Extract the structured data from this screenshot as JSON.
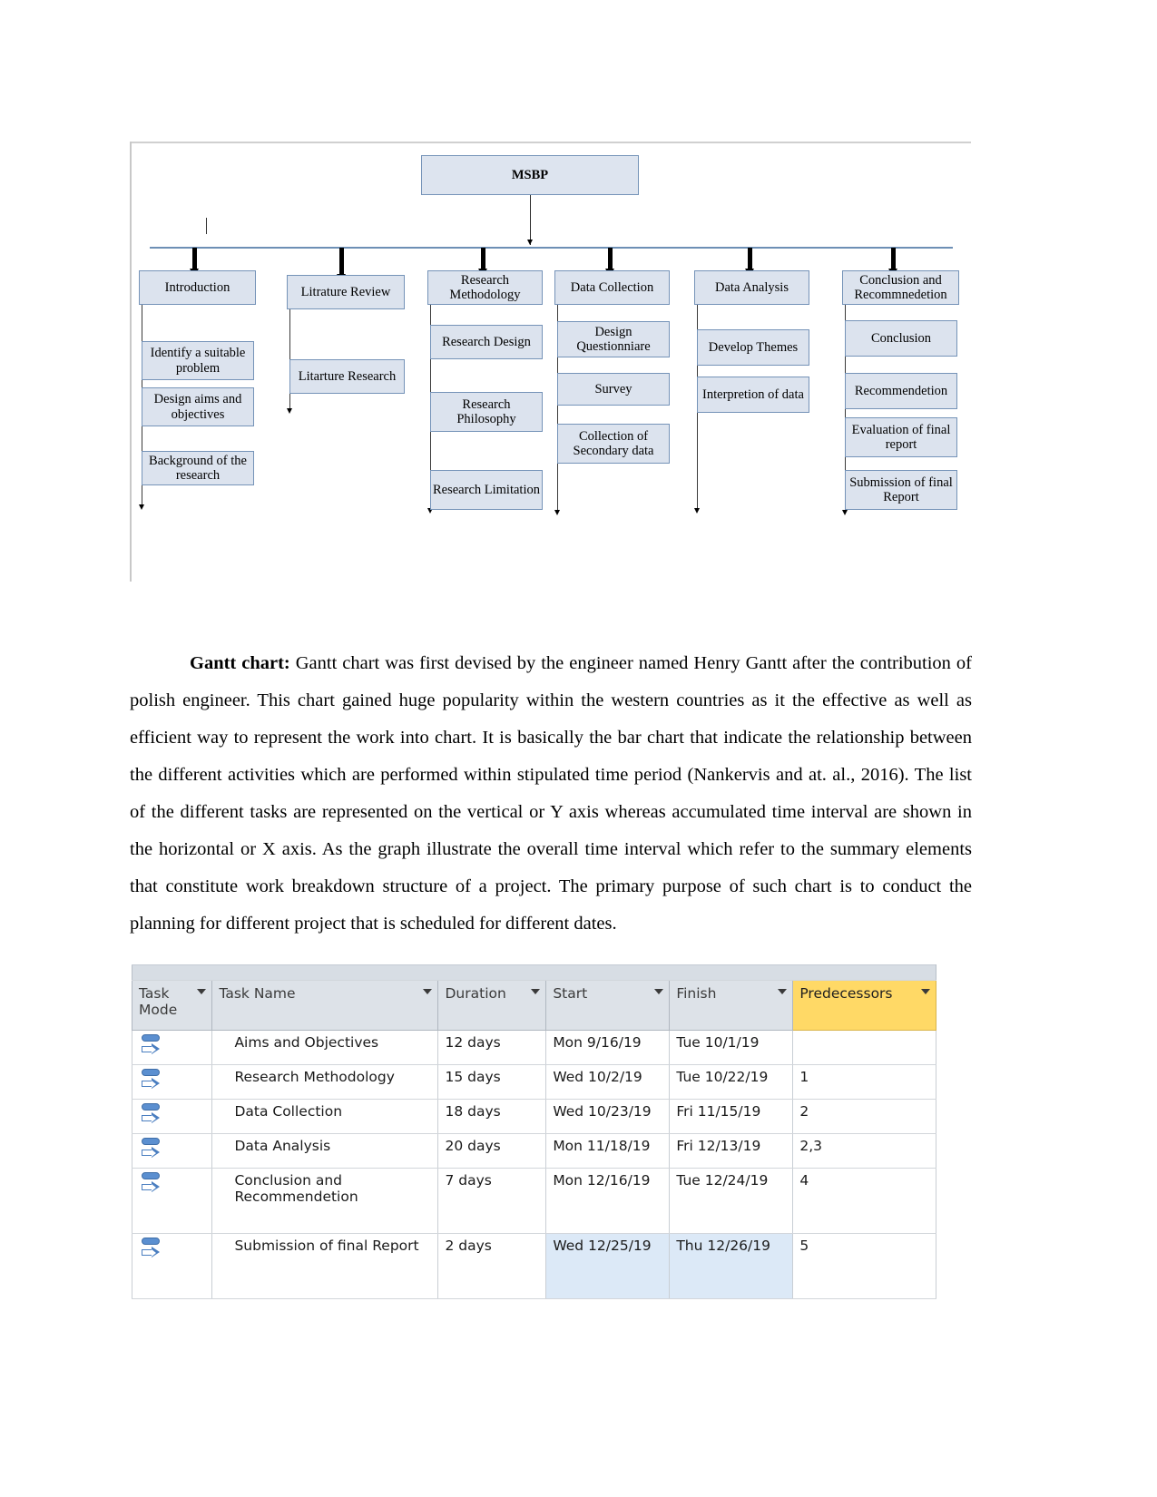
{
  "diagram": {
    "root": {
      "label": "MSBP"
    },
    "columns": [
      {
        "head": "Introduction",
        "children": [
          "Identify a suitable problem",
          "Design aims and objectives",
          "Background of the research"
        ]
      },
      {
        "head": "Litrature Review",
        "children": [
          "Litarture Research"
        ]
      },
      {
        "head": "Research Methodology",
        "children": [
          "Research Design",
          "Research Philosophy",
          "Research Limitation"
        ]
      },
      {
        "head": "Data Collection",
        "children": [
          "Design Questionniare",
          "Survey",
          "Collection of Secondary data"
        ]
      },
      {
        "head": "Data Analysis",
        "children": [
          "Develop Themes",
          "Interpretion of data"
        ]
      },
      {
        "head": "Conclusion and Recommnedetion",
        "children": [
          "Conclusion",
          "Recommendetion",
          "Evaluation of final report",
          "Submission of final Report"
        ]
      }
    ]
  },
  "paragraph": {
    "lead_bold": "Gantt chart:",
    "text": " Gantt chart was first devised by the engineer named Henry Gantt after the contribution of polish engineer. This chart gained huge popularity within the western countries as it the effective as well as efficient way to represent the work into chart. It is basically the bar chart that indicate the relationship between the different activities which are performed within stipulated time period (Nankervis and at. al., 2016). The list of the different tasks are represented on the vertical or Y axis whereas accumulated time interval are shown in the horizontal or X axis.  As the graph illustrate the overall time interval which refer to the summary elements that constitute work breakdown structure of a project. The primary purpose of such chart is to conduct the planning for different project that is scheduled for different dates."
  },
  "gantt_table": {
    "headers": {
      "task_mode": "Task\nMode",
      "task_name": "Task Name",
      "duration": "Duration",
      "start": "Start",
      "finish": "Finish",
      "predecessors": "Predecessors"
    },
    "highlight_color": "#ffd966",
    "selection_color": "#dce9f7",
    "rows": [
      {
        "name": "Aims and Objectives",
        "duration": "12 days",
        "start": "Mon 9/16/19",
        "finish": "Tue 10/1/19",
        "predecessors": "",
        "selected": false
      },
      {
        "name": "Research Methodology",
        "duration": "15 days",
        "start": "Wed 10/2/19",
        "finish": "Tue 10/22/19",
        "predecessors": "1",
        "selected": false
      },
      {
        "name": "Data Collection",
        "duration": "18 days",
        "start": "Wed 10/23/19",
        "finish": "Fri 11/15/19",
        "predecessors": "2",
        "selected": false
      },
      {
        "name": "Data Analysis",
        "duration": "20 days",
        "start": "Mon 11/18/19",
        "finish": "Fri 12/13/19",
        "predecessors": "2,3",
        "selected": false
      },
      {
        "name": "Conclusion and Recommendetion",
        "duration": "7 days",
        "start": "Mon 12/16/19",
        "finish": "Tue 12/24/19",
        "predecessors": "4",
        "selected": false
      },
      {
        "name": "Submission of final Report",
        "duration": "2 days",
        "start": "Wed 12/25/19",
        "finish": "Thu 12/26/19",
        "predecessors": "5",
        "selected": true
      }
    ]
  }
}
